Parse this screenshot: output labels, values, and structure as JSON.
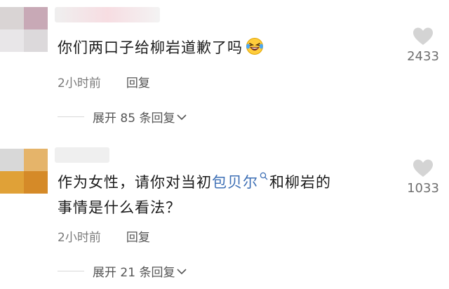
{
  "comments": [
    {
      "text": "你们两口子给柳岩道歉了吗",
      "emoji": "laughing-tears-icon",
      "time": "2小时前",
      "reply_label": "回复",
      "expand_label": "展开 85 条回复",
      "like_count": "2433",
      "avatar_colors": [
        "#d9d4d4",
        "#c8a9b6",
        "#e8e6e8",
        "#dcd9db"
      ],
      "username_colors": [
        "#f1f1f1",
        "#f7dde2"
      ]
    },
    {
      "text_before": "作为女性，请你对当初",
      "mention": "包贝尔",
      "text_after": "和柳岩的",
      "text_line2": "事情是什么看法？",
      "time": "2小时前",
      "reply_label": "回复",
      "expand_label": "展开 21 条回复",
      "like_count": "1033",
      "avatar_colors": [
        "#d8d8d8",
        "#e5b46a",
        "#e0a137",
        "#d58a28"
      ],
      "username_colors": [
        "#ececec",
        "#f0f0f0"
      ]
    }
  ],
  "colors": {
    "mention": "#3d6fb5",
    "meta_text": "#7a7a7a",
    "like_heart": "#d4d4d4"
  }
}
